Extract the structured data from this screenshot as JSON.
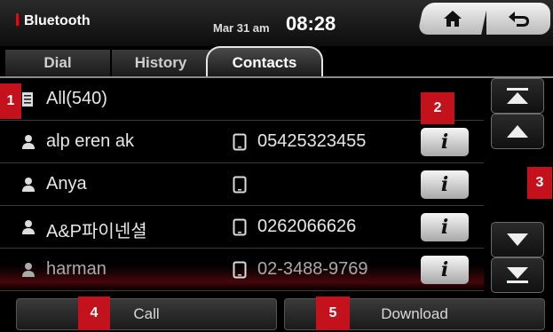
{
  "header": {
    "title": "Bluetooth",
    "date": "Mar 31 am",
    "time": "08:28",
    "home_icon": "home-icon",
    "back_icon": "back-icon"
  },
  "tabs": [
    {
      "label": "Dial",
      "active": false
    },
    {
      "label": "History",
      "active": false
    },
    {
      "label": "Contacts",
      "active": true
    }
  ],
  "list": {
    "all_label": "All(540)",
    "contacts": [
      {
        "name": "alp eren ak",
        "phone": "05425323455"
      },
      {
        "name": "Anya",
        "phone": ""
      },
      {
        "name": "A&P파이넨셜",
        "phone": "0262066626"
      },
      {
        "name": "harman",
        "phone": "02-3488-9769"
      }
    ],
    "info_label": "i"
  },
  "bottom": {
    "call_label": "Call",
    "download_label": "Download"
  },
  "markers": [
    "1",
    "2",
    "3",
    "4",
    "5"
  ],
  "colors": {
    "accent": "#c4121c",
    "background": "#000000"
  }
}
